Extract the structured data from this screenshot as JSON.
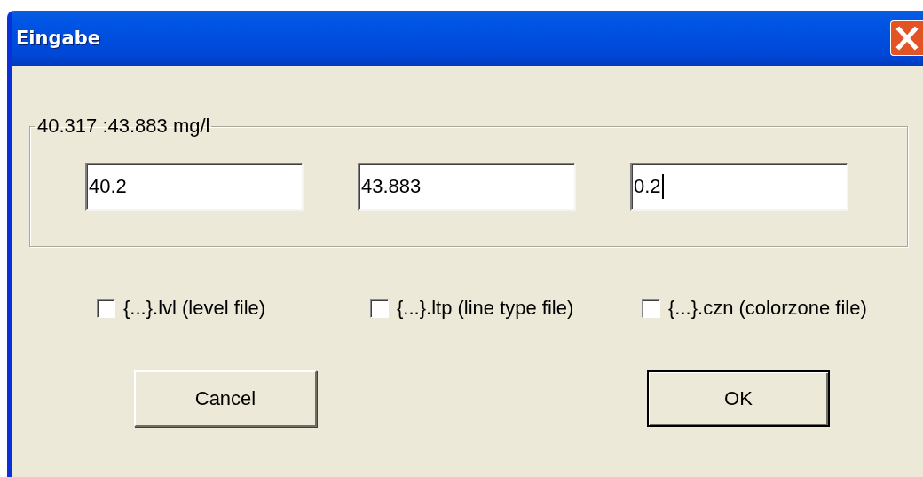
{
  "window": {
    "title": "Eingabe"
  },
  "group": {
    "label": "40.317 :43.883 mg/l",
    "fields": [
      {
        "value": "40.2",
        "focused": false
      },
      {
        "value": "43.883",
        "focused": false
      },
      {
        "value": "0.2",
        "focused": true
      }
    ]
  },
  "checkboxes": [
    {
      "label": "{...}.lvl (level file)",
      "checked": false
    },
    {
      "label": "{...}.ltp (line type file)",
      "checked": false
    },
    {
      "label": "{...}.czn (colorzone file)",
      "checked": false
    }
  ],
  "buttons": [
    {
      "label": "Cancel",
      "default": false
    },
    {
      "label": "OK",
      "default": true
    }
  ]
}
